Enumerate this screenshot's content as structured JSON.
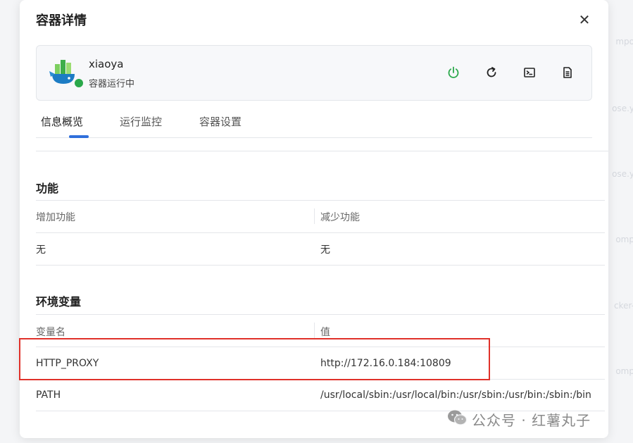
{
  "background": {
    "fragments": [
      "mpo",
      "ose.y",
      "ose.y",
      "omp",
      "cker-",
      "omp"
    ]
  },
  "modal": {
    "title": "容器详情",
    "close_label": "✕"
  },
  "container": {
    "name": "xiaoya",
    "status": "容器运行中",
    "status_color": "#2aa84a",
    "actions": [
      {
        "name": "power-icon",
        "color": "#2aa84a"
      },
      {
        "name": "restart-icon",
        "color": "#222222"
      },
      {
        "name": "terminal-icon",
        "color": "#222222"
      },
      {
        "name": "log-icon",
        "color": "#222222"
      }
    ]
  },
  "tabs": [
    {
      "label": "信息概览",
      "active": true
    },
    {
      "label": "运行监控",
      "active": false
    },
    {
      "label": "容器设置",
      "active": false
    }
  ],
  "accent_color": "#2f6fdb",
  "capabilities": {
    "title": "功能",
    "headers": [
      "增加功能",
      "减少功能"
    ],
    "row": [
      "无",
      "无"
    ]
  },
  "env": {
    "title": "环境变量",
    "headers": [
      "变量名",
      "值"
    ],
    "rows": [
      {
        "name": "HTTP_PROXY",
        "value": "http://172.16.0.184:10809"
      },
      {
        "name": "PATH",
        "value": "/usr/local/sbin:/usr/local/bin:/usr/sbin:/usr/bin:/sbin:/bin"
      }
    ],
    "highlight_color": "#e0312a"
  },
  "watermark": {
    "text": "公众号 · 红薯丸子"
  }
}
